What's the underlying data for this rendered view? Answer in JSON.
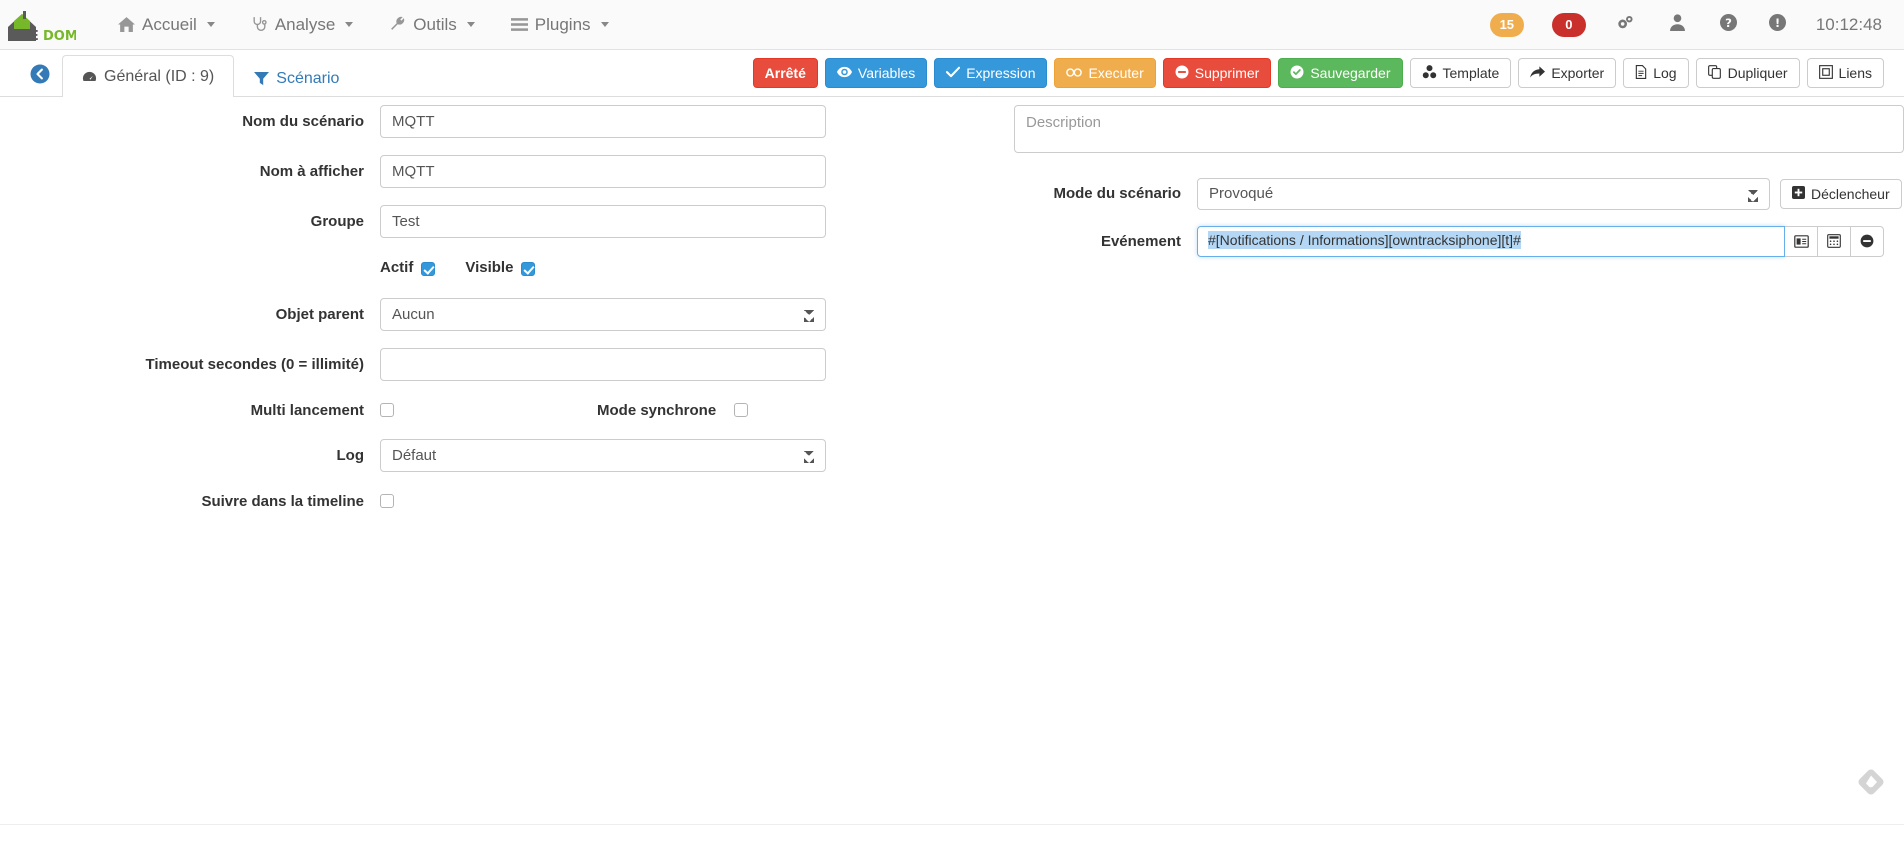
{
  "topbar": {
    "brand": "JEEDOM",
    "nav": [
      {
        "label": "Accueil",
        "icon": "home-icon",
        "caret": true
      },
      {
        "label": "Analyse",
        "icon": "stethoscope-icon",
        "caret": true
      },
      {
        "label": "Outils",
        "icon": "wrench-icon",
        "caret": true
      },
      {
        "label": "Plugins",
        "icon": "list-icon",
        "caret": true
      }
    ],
    "badges": [
      {
        "name": "warning-count-badge",
        "value": "15",
        "color": "#f0ad4e"
      },
      {
        "name": "error-count-badge",
        "value": "0",
        "color": "#c9302c"
      }
    ],
    "icons": [
      {
        "name": "gears-icon",
        "caret": true
      },
      {
        "name": "user-icon",
        "caret": true
      },
      {
        "name": "help-icon",
        "caret": false
      },
      {
        "name": "info-icon",
        "caret": false
      }
    ],
    "clock": "10:12:48"
  },
  "tabs": [
    {
      "label": "Général (ID : 9)",
      "icon": "dashboard-icon",
      "active": true
    },
    {
      "label": "Scénario",
      "icon": "filter-icon",
      "active": false
    }
  ],
  "toolbar": {
    "status_label": "Arrêté",
    "variables_label": "Variables",
    "expression_label": "Expression",
    "executer_label": "Executer",
    "supprimer_label": "Supprimer",
    "sauvegarder_label": "Sauvegarder",
    "template_label": "Template",
    "exporter_label": "Exporter",
    "log_label": "Log",
    "dupliquer_label": "Dupliquer",
    "liens_label": "Liens"
  },
  "form": {
    "nom_scenario": {
      "label": "Nom du scénario",
      "value": "MQTT"
    },
    "nom_afficher": {
      "label": "Nom à afficher",
      "value": "MQTT"
    },
    "groupe": {
      "label": "Groupe",
      "value": "Test"
    },
    "actif": {
      "label": "Actif",
      "checked": true
    },
    "visible": {
      "label": "Visible",
      "checked": true
    },
    "objet_parent": {
      "label": "Objet parent",
      "value": "Aucun"
    },
    "timeout": {
      "label": "Timeout secondes (0 = illimité)",
      "value": ""
    },
    "multi": {
      "label": "Multi lancement",
      "checked": false
    },
    "synchrone": {
      "label": "Mode synchrone",
      "checked": false
    },
    "log": {
      "label": "Log",
      "value": "Défaut"
    },
    "timeline": {
      "label": "Suivre dans la timeline",
      "checked": false
    }
  },
  "right": {
    "description_placeholder": "Description",
    "description_value": "",
    "mode_label": "Mode du scénario",
    "mode_value": "Provoqué",
    "declencheur_label": "Déclencheur",
    "evenement_label": "Evénement",
    "evenement_value": "#[Notifications / Informations][owntracksiphone][t]#",
    "evt_buttons": [
      {
        "name": "select-command-icon"
      },
      {
        "name": "calculator-icon"
      },
      {
        "name": "remove-icon"
      }
    ]
  },
  "colors": {
    "accent_blue": "#3498db",
    "danger_red": "#e74c3c",
    "success_green": "#5cb85c",
    "warning_orange": "#f0ad4e",
    "brand_green": "#77b82a"
  }
}
